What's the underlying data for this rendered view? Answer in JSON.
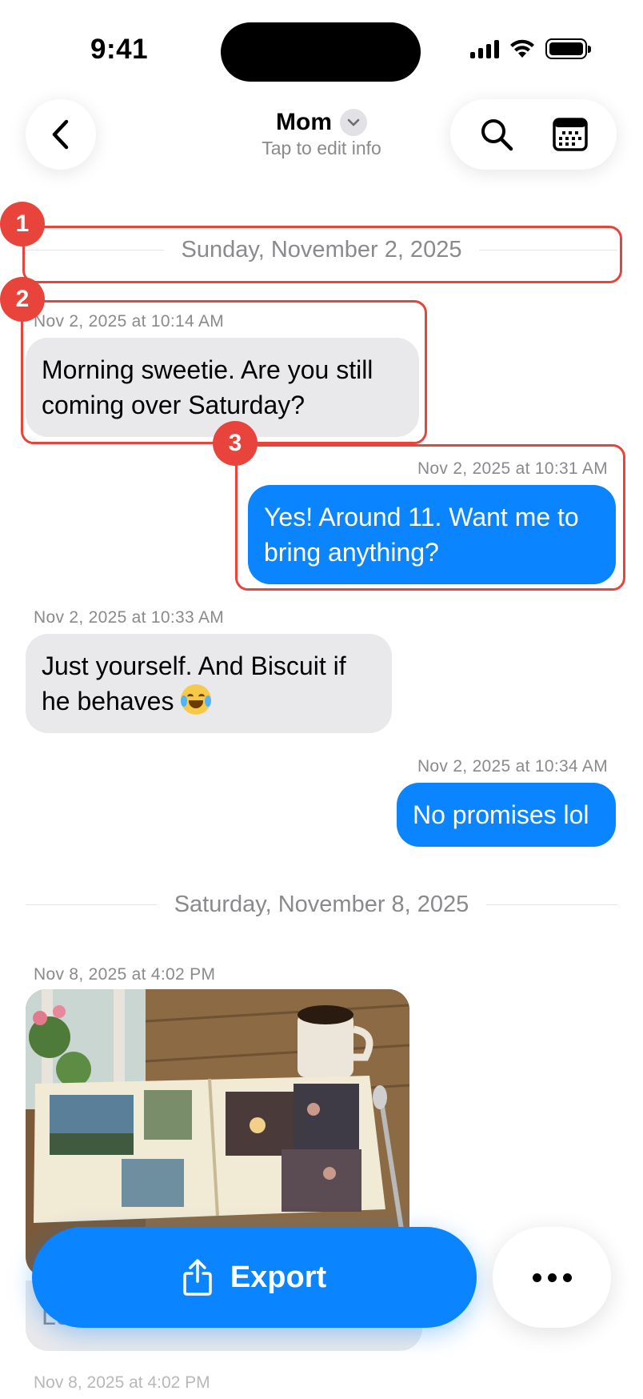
{
  "status_bar": {
    "time": "9:41"
  },
  "header": {
    "back_icon": "chevron-left-icon",
    "contact_name": "Mom",
    "contact_subtitle": "Tap to edit info",
    "search_icon": "search-icon",
    "calendar_icon": "calendar-icon"
  },
  "colors": {
    "outgoing_bubble": "#0a84ff",
    "incoming_bubble": "#e9e9eb",
    "annotation": "#e8443b"
  },
  "annotations": [
    "1",
    "2",
    "3"
  ],
  "date_separators": [
    "Sunday, November 2, 2025",
    "Saturday, November 8, 2025"
  ],
  "messages": [
    {
      "direction": "incoming",
      "timestamp": "Nov 2, 2025 at 10:14 AM",
      "text": "Morning sweetie. Are you still coming over Saturday?"
    },
    {
      "direction": "outgoing",
      "timestamp": "Nov 2, 2025 at 10:31 AM",
      "text": "Yes! Around 11. Want me to bring anything?"
    },
    {
      "direction": "incoming",
      "timestamp": "Nov 2, 2025 at 10:33 AM",
      "text": "Just yourself. And Biscuit if he behaves",
      "emoji": "face-with-tears-of-joy"
    },
    {
      "direction": "outgoing",
      "timestamp": "Nov 2, 2025 at 10:34 AM",
      "text": "No promises lol"
    },
    {
      "direction": "incoming",
      "timestamp": "Nov 8, 2025 at 4:02 PM",
      "attachment": "photo"
    },
    {
      "direction": "incoming",
      "text": "Lo"
    }
  ],
  "footer": {
    "export_label": "Export",
    "export_icon": "share-icon",
    "more_icon": "ellipsis-icon",
    "last_timestamp": "Nov 8, 2025 at 4:02 PM"
  }
}
